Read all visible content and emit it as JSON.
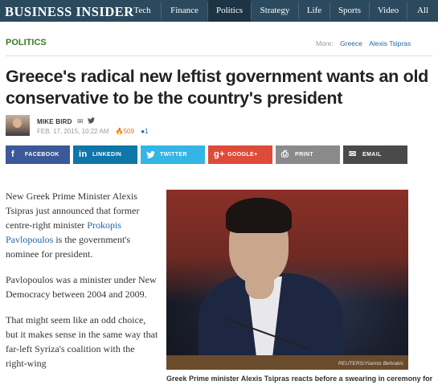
{
  "nav": {
    "logo": "BUSINESS INSIDER",
    "items": [
      {
        "label": "Tech"
      },
      {
        "label": "Finance"
      },
      {
        "label": "Politics"
      },
      {
        "label": "Strategy"
      },
      {
        "label": "Life"
      },
      {
        "label": "Sports"
      },
      {
        "label": "Video"
      },
      {
        "label": "All"
      }
    ],
    "active": "Politics",
    "bg_color": "#2c4a5e"
  },
  "section": {
    "label": "POLITICS",
    "more_label": "More:",
    "tags": [
      "Greece",
      "Alexis Tsipras"
    ]
  },
  "article": {
    "headline": "Greece's radical new leftist government wants an old conservative to be the country's president",
    "author": "MIKE BIRD",
    "author_icons": [
      "email-icon",
      "twitter-icon"
    ],
    "date": "FEB. 17, 2015, 10:22 AM",
    "views": "509",
    "comments": "1",
    "paragraphs": {
      "p1_before": "New Greek Prime Minister Alexis Tsipras just announced that former centre-right minister ",
      "p1_link": "Prokopis Pavlopoulos",
      "p1_after": " is the government's nominee for president.",
      "p2": "Pavlopoulos was a minister under New Democracy between 2004 and 2009.",
      "p3": "That might seem like an odd choice, but it makes sense in the same way that far-left Syriza's coalition with the right-wing"
    },
    "photo_credit": "REUTERS/Yiannis Behrakis",
    "caption": "Greek Prime minister Alexis Tsipras reacts before a swearing in ceremony for"
  },
  "share": [
    {
      "label": "FACEBOOK",
      "icon": "f",
      "color": "#3b5998"
    },
    {
      "label": "LINKEDIN",
      "icon": "in",
      "color": "#0e76a8"
    },
    {
      "label": "TWITTER",
      "icon": "🐦",
      "color": "#33b5e5"
    },
    {
      "label": "GOOGLE+",
      "icon": "g+",
      "color": "#dd4b39"
    },
    {
      "label": "PRINT",
      "icon": "⎙",
      "color": "#8a8a8a"
    },
    {
      "label": "EMAIL",
      "icon": "✉",
      "color": "#4a4a4a"
    }
  ]
}
